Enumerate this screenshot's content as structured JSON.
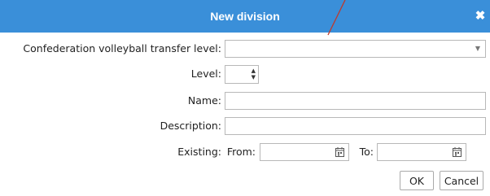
{
  "dialog": {
    "title": "New division",
    "close_glyph": "✖"
  },
  "form": {
    "confederation_label": "Confederation volleyball transfer level:",
    "confederation_value": "",
    "level_label": "Level:",
    "level_value": "",
    "name_label": "Name:",
    "name_value": "",
    "description_label": "Description:",
    "description_value": "",
    "existing_label": "Existing:",
    "from_label": "From:",
    "from_value": "",
    "to_label": "To:",
    "to_value": ""
  },
  "buttons": {
    "ok_label": "OK",
    "cancel_label": "Cancel"
  },
  "icons": {
    "dropdown": "chevron-down-icon",
    "spinner_up": "spinner-up-icon",
    "spinner_down": "spinner-down-icon",
    "calendar": "calendar-icon",
    "close": "close-icon"
  },
  "colors": {
    "titlebar": "#3a8fd9",
    "annotation_line": "#c0392b"
  }
}
